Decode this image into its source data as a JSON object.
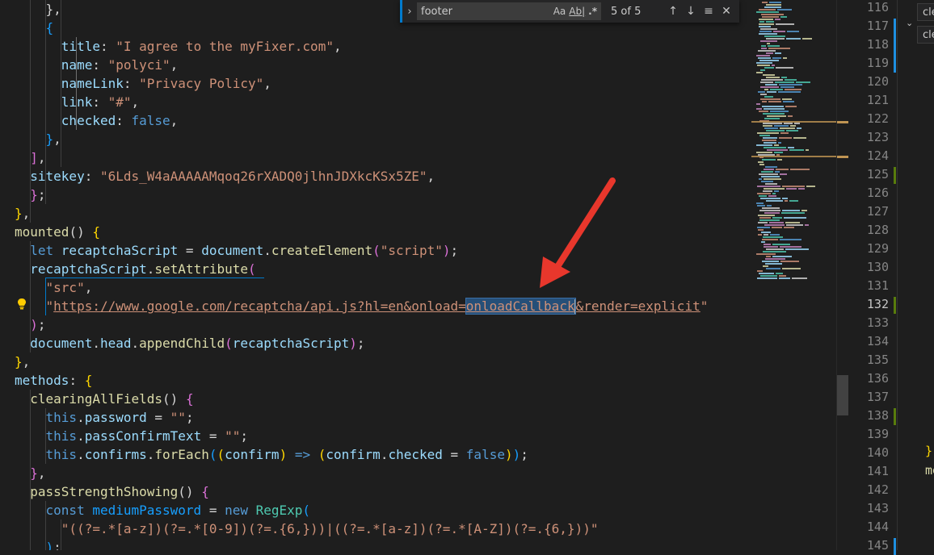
{
  "find": {
    "query": "footer",
    "match_case_label": "Aa",
    "whole_word_label": "Ab|",
    "regex_label": ".*",
    "count": "5 of 5",
    "prev_icon": "arrow-up-icon",
    "next_icon": "arrow-down-icon",
    "selection_icon": "find-in-selection-icon",
    "close_icon": "close-icon"
  },
  "code": [
    [
      [
        "    }",
        "p"
      ],
      [
        ",",
        "p"
      ]
    ],
    [
      [
        "    {",
        "c"
      ]
    ],
    [
      [
        "      title",
        "k"
      ],
      [
        ": ",
        "p"
      ],
      [
        "\"I agree to the myFixer.com\"",
        "s"
      ],
      [
        ",",
        "p"
      ]
    ],
    [
      [
        "      name",
        "k"
      ],
      [
        ": ",
        "p"
      ],
      [
        "\"polyci\"",
        "s"
      ],
      [
        ",",
        "p"
      ]
    ],
    [
      [
        "      nameLink",
        "k"
      ],
      [
        ": ",
        "p"
      ],
      [
        "\"Privacy Policy\"",
        "s"
      ],
      [
        ",",
        "p"
      ]
    ],
    [
      [
        "      link",
        "k"
      ],
      [
        ": ",
        "p"
      ],
      [
        "\"#\"",
        "s"
      ],
      [
        ",",
        "p"
      ]
    ],
    [
      [
        "      checked",
        "k"
      ],
      [
        ": ",
        "p"
      ],
      [
        "false",
        "b"
      ],
      [
        ",",
        "p"
      ]
    ],
    [
      [
        "    }",
        "c"
      ],
      [
        ",",
        "p"
      ]
    ],
    [
      [
        "  ]",
        "m"
      ],
      [
        ",",
        "p"
      ]
    ],
    [
      [
        "  sitekey",
        "k"
      ],
      [
        ": ",
        "p"
      ],
      [
        "\"6Lds_W4aAAAAAMqoq26rXADQ0jlhnJDXkcKSx5ZE\"",
        "s"
      ],
      [
        ",",
        "p"
      ]
    ],
    [
      [
        "  }",
        "m"
      ],
      [
        ";",
        "p"
      ]
    ],
    [
      [
        "}",
        "y"
      ],
      [
        ",",
        "p"
      ]
    ],
    [
      [
        "mounted",
        "f"
      ],
      [
        "() ",
        "p"
      ],
      [
        "{",
        "y"
      ]
    ],
    [
      [
        "  let ",
        "b"
      ],
      [
        "recaptchaScript",
        "k"
      ],
      [
        " = ",
        "p"
      ],
      [
        "document",
        "k"
      ],
      [
        ".",
        "p"
      ],
      [
        "createElement",
        "f"
      ],
      [
        "(",
        "m"
      ],
      [
        "\"script\"",
        "s"
      ],
      [
        ")",
        "m"
      ],
      [
        ";",
        "p"
      ]
    ],
    [
      [
        "  recaptchaScript",
        "k"
      ],
      [
        ".",
        "p"
      ],
      [
        "setAttribute",
        "f"
      ],
      [
        "(",
        "m"
      ]
    ],
    [
      [
        "    \"src\"",
        "s"
      ],
      [
        ",",
        "p"
      ]
    ],
    [
      [
        "    \"",
        "s"
      ],
      [
        "https://www.google.com/recaptcha/api.js?hl=en&onload=",
        "u"
      ],
      [
        "onloadCallback",
        "sel"
      ],
      [
        "&render=explicit",
        "u"
      ],
      [
        "\"",
        "s"
      ]
    ],
    [
      [
        "  )",
        "m"
      ],
      [
        ";",
        "p"
      ]
    ],
    [
      [
        "  document",
        "k"
      ],
      [
        ".",
        "p"
      ],
      [
        "head",
        "k"
      ],
      [
        ".",
        "p"
      ],
      [
        "appendChild",
        "f"
      ],
      [
        "(",
        "m"
      ],
      [
        "recaptchaScript",
        "k"
      ],
      [
        ")",
        "m"
      ],
      [
        ";",
        "p"
      ]
    ],
    [
      [
        "}",
        "y"
      ],
      [
        ",",
        "p"
      ]
    ],
    [
      [
        "methods",
        "k"
      ],
      [
        ": ",
        "p"
      ],
      [
        "{",
        "y"
      ]
    ],
    [
      [
        "  clearingAllFields",
        "f"
      ],
      [
        "() ",
        "p"
      ],
      [
        "{",
        "m"
      ]
    ],
    [
      [
        "    this",
        "b"
      ],
      [
        ".",
        "p"
      ],
      [
        "password",
        "k"
      ],
      [
        " = ",
        "p"
      ],
      [
        "\"\"",
        "s"
      ],
      [
        ";",
        "p"
      ]
    ],
    [
      [
        "    this",
        "b"
      ],
      [
        ".",
        "p"
      ],
      [
        "passConfirmText",
        "k"
      ],
      [
        " = ",
        "p"
      ],
      [
        "\"\"",
        "s"
      ],
      [
        ";",
        "p"
      ]
    ],
    [
      [
        "    this",
        "b"
      ],
      [
        ".",
        "p"
      ],
      [
        "confirms",
        "k"
      ],
      [
        ".",
        "p"
      ],
      [
        "forEach",
        "f"
      ],
      [
        "(",
        "c"
      ],
      [
        "(",
        "y"
      ],
      [
        "confirm",
        "k"
      ],
      [
        ")",
        "y"
      ],
      [
        " => ",
        "b"
      ],
      [
        "(",
        "y"
      ],
      [
        "confirm",
        "k"
      ],
      [
        ".",
        "p"
      ],
      [
        "checked",
        "k"
      ],
      [
        " = ",
        "p"
      ],
      [
        "false",
        "b"
      ],
      [
        ")",
        "y"
      ],
      [
        ")",
        "c"
      ],
      [
        ";",
        "p"
      ]
    ],
    [
      [
        "  }",
        "m"
      ],
      [
        ",",
        "p"
      ]
    ],
    [
      [
        "  passStrengthShowing",
        "f"
      ],
      [
        "() ",
        "p"
      ],
      [
        "{",
        "m"
      ]
    ],
    [
      [
        "    const ",
        "b"
      ],
      [
        "mediumPassword",
        "c"
      ],
      [
        " = ",
        "p"
      ],
      [
        "new ",
        "b"
      ],
      [
        "RegExp",
        "g"
      ],
      [
        "(",
        "c"
      ]
    ],
    [
      [
        "      \"((?=.*[a-z])(?=.*[0-9])(?=.{6,}))|((?=.*[a-z])(?=.*[A-Z])(?=.{6,}))\"",
        "s"
      ]
    ],
    [
      [
        "    )",
        "c"
      ],
      [
        ";",
        "p"
      ]
    ]
  ],
  "line_numbers": [
    "116",
    "117",
    "118",
    "119",
    "120",
    "121",
    "122",
    "123",
    "124",
    "125",
    "126",
    "127",
    "128",
    "129",
    "130",
    "131",
    "132",
    "133",
    "134",
    "135",
    "136",
    "137",
    "138",
    "139",
    "140",
    "141",
    "142",
    "143",
    "144",
    "145"
  ],
  "right_panel": {
    "tab1": "cle",
    "tab2": "cle",
    "text1": "}",
    "text2": "me"
  },
  "icons": {
    "lightbulb": "lightbulb-icon",
    "annotation_arrow": "red-arrow-annotation",
    "expand": "chevron-right-icon",
    "chevron": "chevron-down-icon"
  },
  "colors": {
    "accent": "#007acc",
    "annotation": "#e8372c",
    "selection": "#264f78"
  }
}
